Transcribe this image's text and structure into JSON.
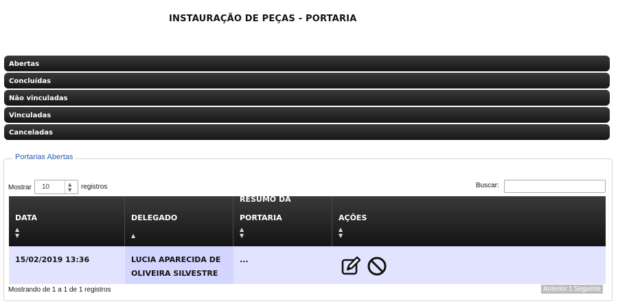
{
  "page": {
    "title": "INSTAURAÇÃO DE PEÇAS - PORTARIA"
  },
  "bars": [
    "Abertas",
    "Concluídas",
    "Não vinculadas",
    "Vinculadas",
    "Canceladas"
  ],
  "panel": {
    "legend": "Portarias Abertas",
    "length_label_before": "Mostrar",
    "length_value": "10",
    "length_label_after": "registros",
    "search_label": "Buscar:",
    "search_value": ""
  },
  "table": {
    "columns": [
      {
        "label_lines": [
          "DATA"
        ],
        "sort": "both"
      },
      {
        "label_lines": [
          "DELEGADO"
        ],
        "sort": "asc"
      },
      {
        "label_lines": [
          "RESUMO DA",
          "PORTARIA"
        ],
        "sort": "both"
      },
      {
        "label_lines": [
          "AÇÕES"
        ],
        "sort": "both"
      }
    ],
    "rows": [
      {
        "data": "15/02/2019 13:36",
        "delegado": [
          "LUCIA APARECIDA DE",
          "OLIVEIRA SILVESTRE"
        ],
        "resumo": "...",
        "actions": [
          "edit-icon",
          "cancel-icon"
        ]
      }
    ]
  },
  "footer": {
    "info": "Mostrando de 1 a 1 de 1 registros",
    "prev": "Anterior",
    "page": "1",
    "next": "Seguinte"
  }
}
